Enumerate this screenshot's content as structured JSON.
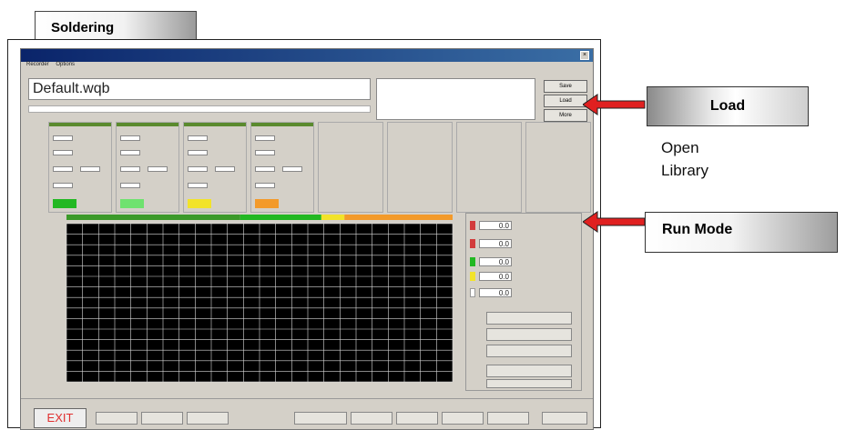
{
  "callouts": {
    "soldering": "Soldering",
    "load": "Load",
    "open_library": [
      "Open",
      "Library"
    ],
    "run_mode": "Run Mode"
  },
  "window": {
    "menu": [
      "Recorder",
      "Options"
    ],
    "filename": "Default.wqb",
    "buttons": {
      "save": "Save",
      "load": "Load",
      "more": "More"
    }
  },
  "zone_colors": [
    "#22b822",
    "#6fe26f",
    "#f2e32a",
    "#f39a2a"
  ],
  "bottombar": {
    "exit": "EXIT"
  },
  "colors": {
    "arrow": "#e02020",
    "plot_bg": "#000000",
    "plot_grid": "#d8d8d8"
  }
}
